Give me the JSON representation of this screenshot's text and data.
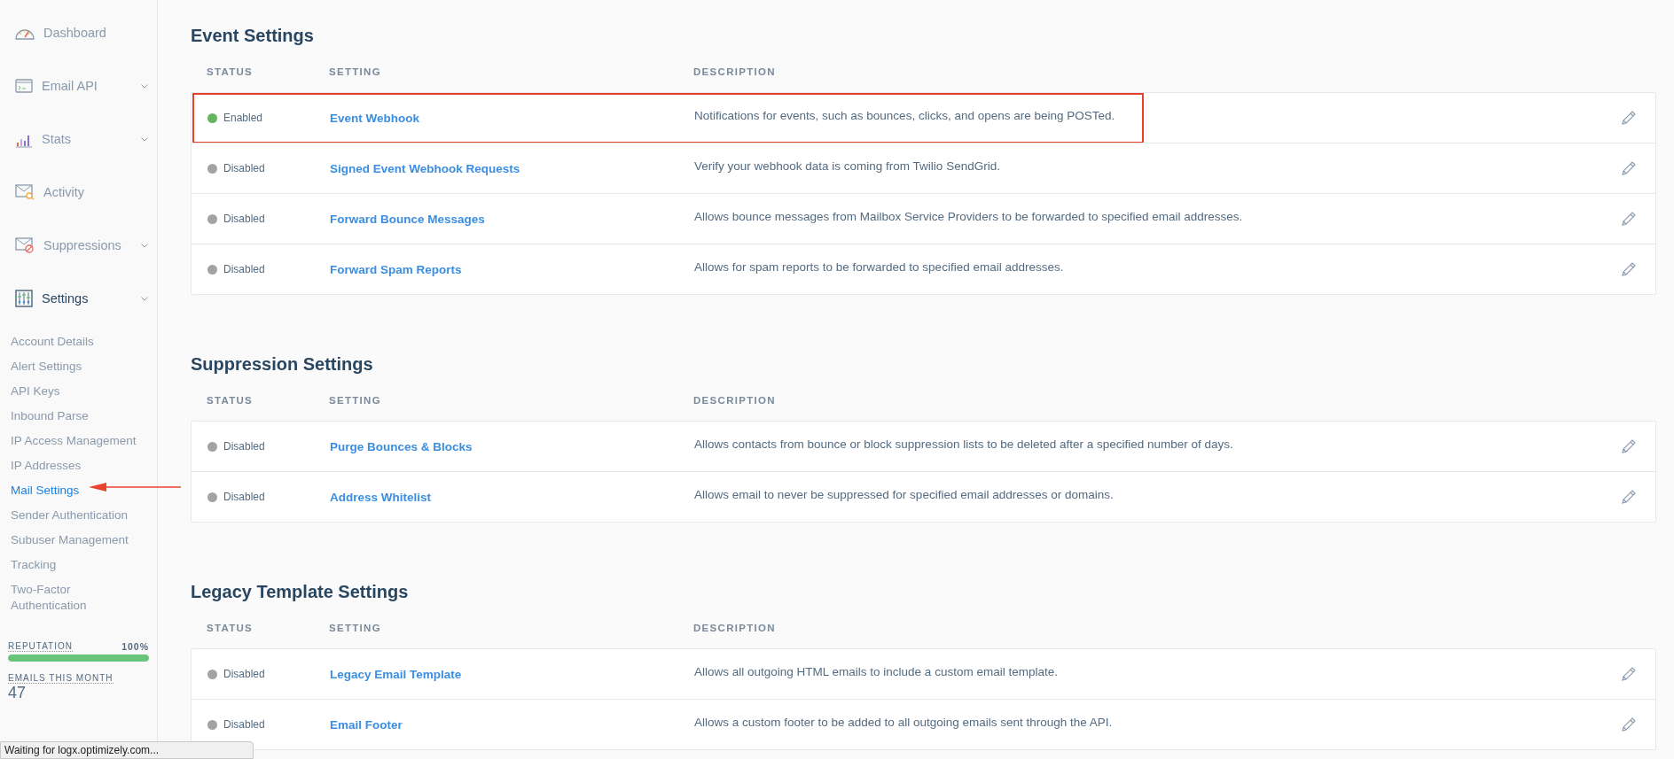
{
  "sidebar": {
    "nav": [
      {
        "label": "Dashboard",
        "expandable": false,
        "selected": false
      },
      {
        "label": "Email API",
        "expandable": true,
        "selected": false
      },
      {
        "label": "Stats",
        "expandable": true,
        "selected": false
      },
      {
        "label": "Activity",
        "expandable": false,
        "selected": false
      },
      {
        "label": "Suppressions",
        "expandable": true,
        "selected": false
      },
      {
        "label": "Settings",
        "expandable": true,
        "selected": true
      }
    ],
    "sub_items": [
      {
        "label": "Account Details",
        "selected": false,
        "arrow": false
      },
      {
        "label": "Alert Settings",
        "selected": false,
        "arrow": false
      },
      {
        "label": "API Keys",
        "selected": false,
        "arrow": false
      },
      {
        "label": "Inbound Parse",
        "selected": false,
        "arrow": false
      },
      {
        "label": "IP Access Management",
        "selected": false,
        "arrow": false
      },
      {
        "label": "IP Addresses",
        "selected": false,
        "arrow": false
      },
      {
        "label": "Mail Settings",
        "selected": true,
        "arrow": true
      },
      {
        "label": "Sender Authentication",
        "selected": false,
        "arrow": false
      },
      {
        "label": "Subuser Management",
        "selected": false,
        "arrow": false
      },
      {
        "label": "Tracking",
        "selected": false,
        "arrow": false
      },
      {
        "label": "Two-Factor Authentication",
        "selected": false,
        "arrow": false
      }
    ],
    "reputation": {
      "label": "REPUTATION",
      "value": "100%",
      "level": 1.0
    },
    "emails": {
      "label": "EMAILS THIS MONTH",
      "value": "47"
    }
  },
  "sections": [
    {
      "title": "Event Settings",
      "columns": [
        "STATUS",
        "SETTING",
        "DESCRIPTION"
      ],
      "rows": [
        {
          "status": "Enabled",
          "enabled": true,
          "setting": "Event Webhook",
          "description": "Notifications for events, such as bounces, clicks, and opens are being POSTed.",
          "highlighted": true
        },
        {
          "status": "Disabled",
          "enabled": false,
          "setting": "Signed Event Webhook Requests",
          "description": "Verify your webhook data is coming from Twilio SendGrid.",
          "highlighted": false
        },
        {
          "status": "Disabled",
          "enabled": false,
          "setting": "Forward Bounce Messages",
          "description": "Allows bounce messages from Mailbox Service Providers to be forwarded to specified email addresses.",
          "highlighted": false
        },
        {
          "status": "Disabled",
          "enabled": false,
          "setting": "Forward Spam Reports",
          "description": "Allows for spam reports to be forwarded to specified email addresses.",
          "highlighted": false
        }
      ]
    },
    {
      "title": "Suppression Settings",
      "columns": [
        "STATUS",
        "SETTING",
        "DESCRIPTION"
      ],
      "rows": [
        {
          "status": "Disabled",
          "enabled": false,
          "setting": "Purge Bounces & Blocks",
          "description": "Allows contacts from bounce or block suppression lists to be deleted after a specified number of days.",
          "highlighted": false
        },
        {
          "status": "Disabled",
          "enabled": false,
          "setting": "Address Whitelist",
          "description": "Allows email to never be suppressed for specified email addresses or domains.",
          "highlighted": false
        }
      ]
    },
    {
      "title": "Legacy Template Settings",
      "columns": [
        "STATUS",
        "SETTING",
        "DESCRIPTION"
      ],
      "rows": [
        {
          "status": "Disabled",
          "enabled": false,
          "setting": "Legacy Email Template",
          "description": "Allows all outgoing HTML emails to include a custom email template.",
          "highlighted": false
        },
        {
          "status": "Disabled",
          "enabled": false,
          "setting": "Email Footer",
          "description": "Allows a custom footer to be added to all outgoing emails sent through the API.",
          "highlighted": false
        }
      ]
    }
  ],
  "status_bar": "Waiting for logx.optimizely.com..."
}
